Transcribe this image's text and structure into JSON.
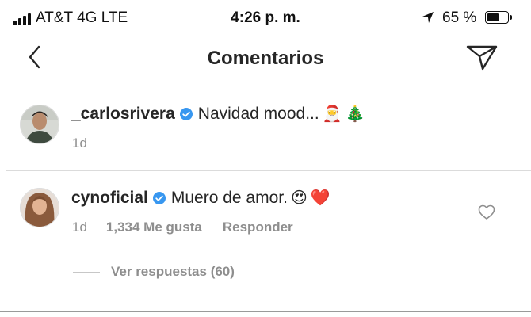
{
  "status_bar": {
    "carrier": "AT&T 4G  LTE",
    "time": "4:26 p. m.",
    "battery": "65 %",
    "battery_level": 0.65,
    "icons": [
      "signal-bars-icon",
      "location-arrow-icon",
      "battery-icon"
    ]
  },
  "nav": {
    "title": "Comentarios",
    "icons": [
      "chevron-left-icon",
      "paper-plane-icon"
    ]
  },
  "caption": {
    "username": "_carlosrivera",
    "text": "Navidad mood...",
    "emojis": [
      "🎅",
      "🎄"
    ],
    "age": "1d",
    "verified": true
  },
  "comment": {
    "username": "cynoficial",
    "text": "Muero de amor.",
    "emojis": [
      "😍",
      "❤️"
    ],
    "age": "1d",
    "likes": "1,334 Me gusta",
    "reply_label": "Responder",
    "verified": true
  },
  "view_replies": "Ver respuestas (60)",
  "colors": {
    "text": "#262626",
    "meta": "#8e8e8e",
    "verified": "#3897f0",
    "divider": "#dbdbdb",
    "heart": "#ed2c46"
  }
}
